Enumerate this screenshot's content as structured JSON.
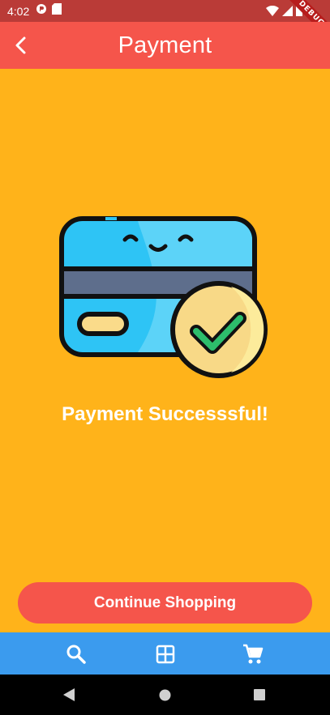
{
  "status_bar": {
    "time": "4:02",
    "debug_label": "DEBUG",
    "icons": [
      "app-notification-icon",
      "sd-card-icon",
      "wifi-icon",
      "cell-signal-icon",
      "battery-icon"
    ]
  },
  "app_bar": {
    "title": "Payment",
    "back_icon": "chevron-left-icon"
  },
  "main": {
    "illustration": "credit-card-success-illustration",
    "message": "Payment Successsful!",
    "continue_label": "Continue Shopping"
  },
  "bottom_nav": {
    "items": [
      {
        "icon": "search-icon"
      },
      {
        "icon": "grid-icon"
      },
      {
        "icon": "cart-icon"
      }
    ]
  },
  "system_nav": [
    "back-triangle-icon",
    "home-circle-icon",
    "recents-square-icon"
  ],
  "colors": {
    "background": "#FFB31A",
    "app_bar": "#F5554B",
    "status_bar": "#BA3B37",
    "button": "#F5554B",
    "bottom_nav": "#3B9BEE",
    "card_blue": "#2EC4F5",
    "check_green": "#2DBE6C"
  }
}
